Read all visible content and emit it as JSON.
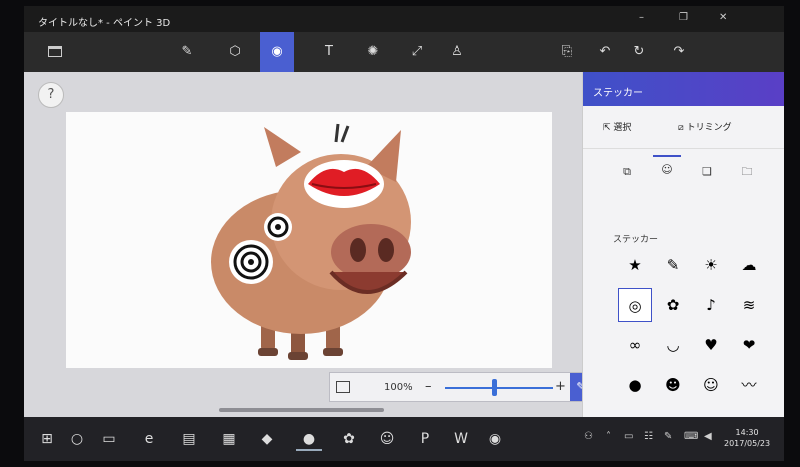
{
  "window": {
    "title": "タイトルなし* - ペイント 3D",
    "controls": [
      "–",
      "❐",
      "✕"
    ]
  },
  "toolbar": {
    "tools": [
      {
        "name": "brush-tool",
        "glyph": "✎"
      },
      {
        "name": "3d-objects-tool",
        "glyph": "⬡"
      },
      {
        "name": "stickers-tool",
        "glyph": "◉"
      },
      {
        "name": "text-tool",
        "glyph": "T"
      },
      {
        "name": "effects-tool",
        "glyph": "✺"
      },
      {
        "name": "canvas-tool",
        "glyph": "⤢"
      },
      {
        "name": "remix3d-tool",
        "glyph": "♙"
      }
    ],
    "right": [
      {
        "name": "paste-icon",
        "glyph": "⎘"
      },
      {
        "name": "undo-icon",
        "glyph": "↶"
      },
      {
        "name": "history-icon",
        "glyph": "↻"
      },
      {
        "name": "redo-icon",
        "glyph": "↷"
      }
    ]
  },
  "canvas": {
    "help_label": "?"
  },
  "zoom": {
    "value": "100%",
    "minus": "–",
    "plus": "+",
    "level_percent": 45
  },
  "panel": {
    "title": "ステッカー",
    "select_label": "選択",
    "crop_label": "トリミング",
    "section_label": "ステッカー",
    "tabs": [
      "⧉",
      "☺",
      "❏",
      "🗀"
    ],
    "stickers": [
      "★",
      "✎",
      "☀",
      "☁",
      "◎",
      "✿",
      "♪",
      "≋",
      "∞",
      "◡",
      "♥",
      "❤",
      "●",
      "☻",
      "☺",
      "〰"
    ]
  },
  "taskbar": {
    "apps": [
      "⊞",
      "○",
      "▭",
      "e",
      "▤",
      "▦",
      "◆",
      "●",
      "✿",
      "☺",
      "P",
      "W",
      "◉"
    ],
    "clock_time": "14:30",
    "clock_date": "2017/05/23"
  },
  "colors": {
    "accent": "#4a5fd1",
    "panel_header": "#3f51c8"
  }
}
